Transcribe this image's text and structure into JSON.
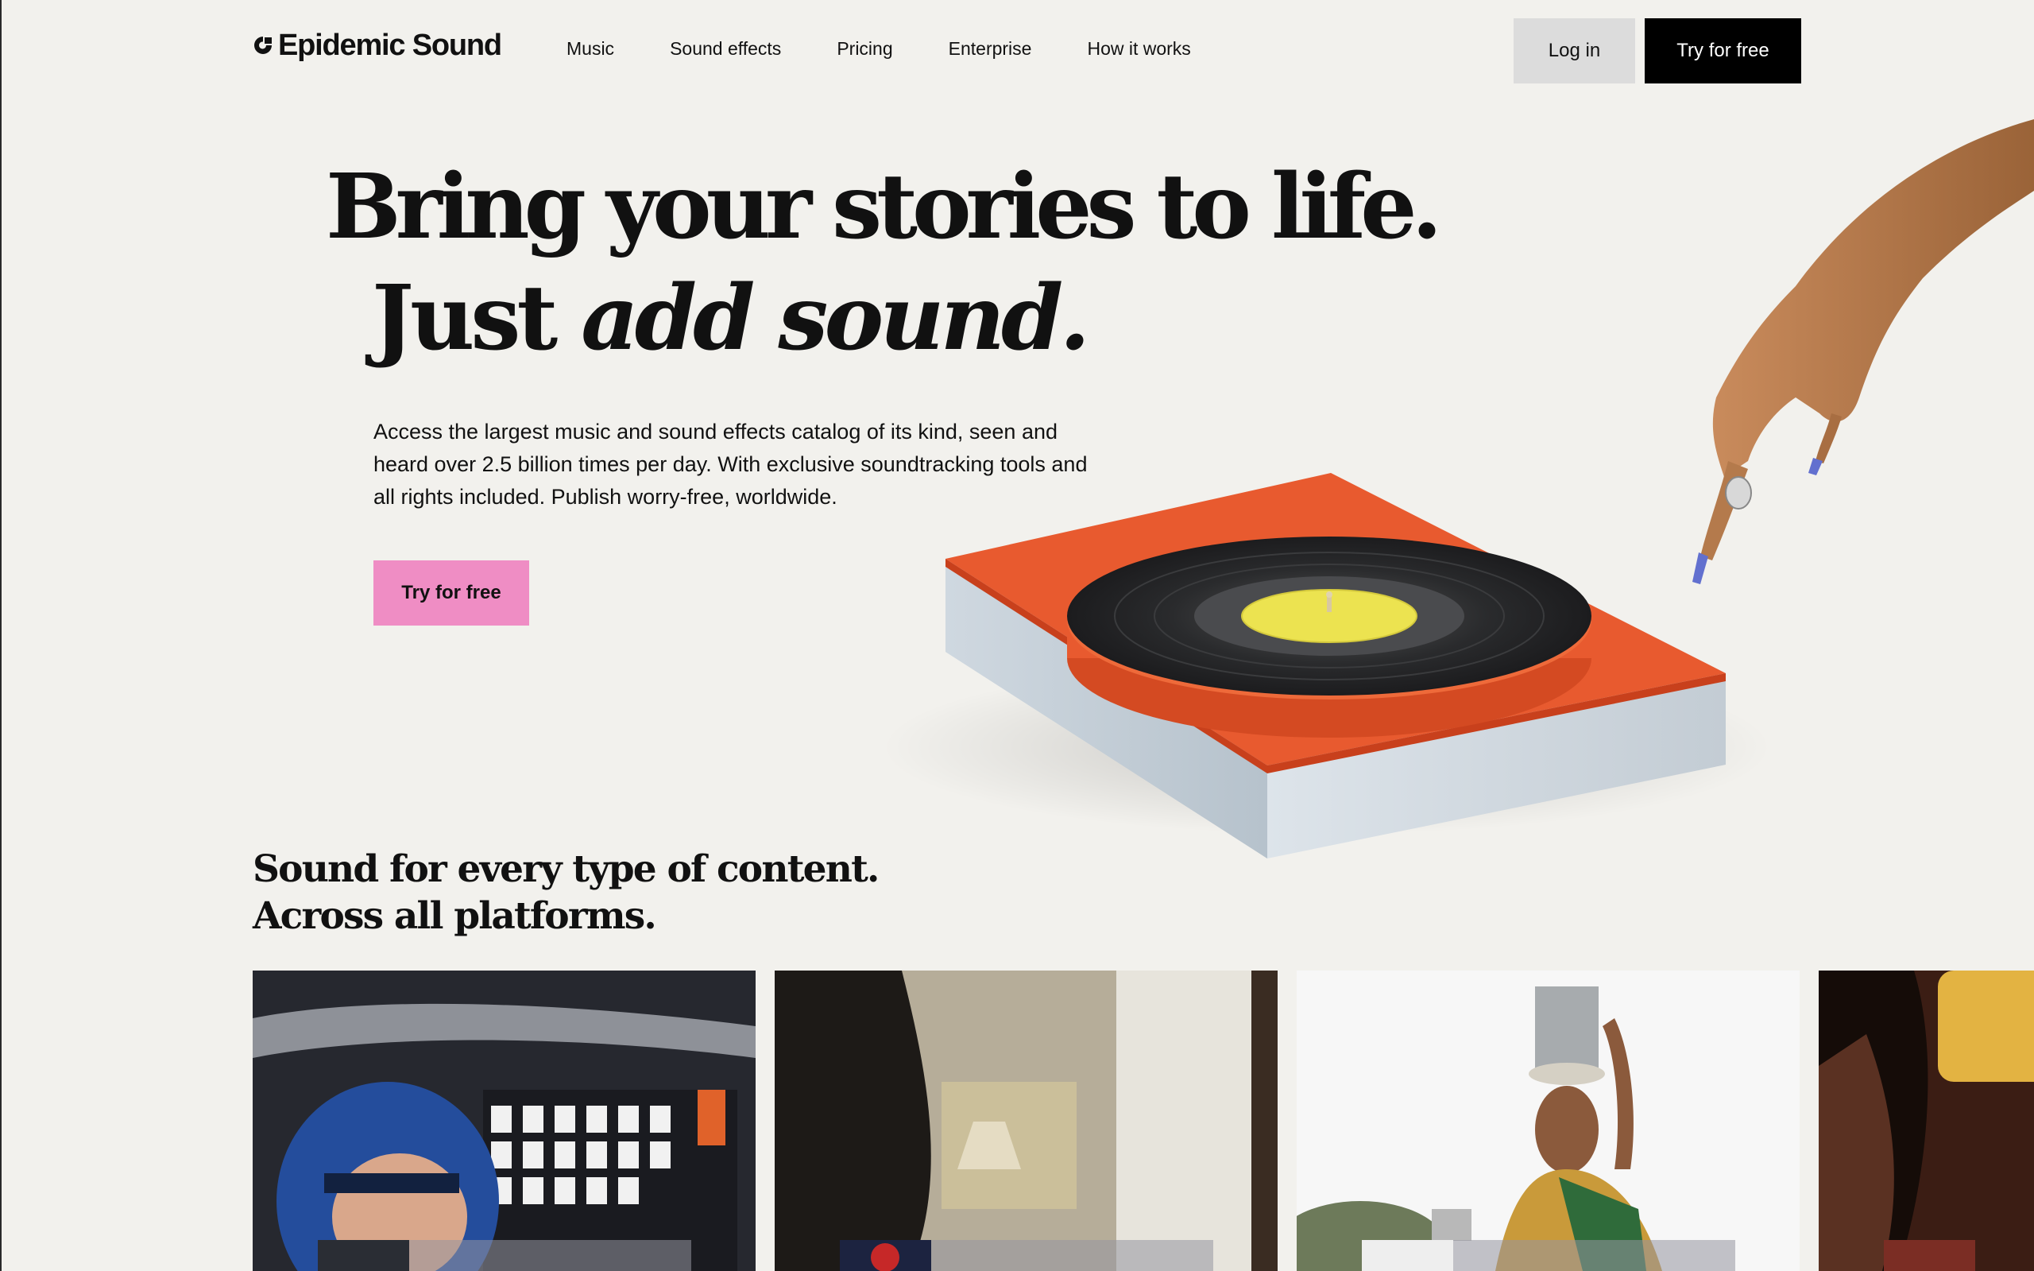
{
  "brand": {
    "name": "Epidemic Sound"
  },
  "nav": {
    "links": [
      "Music",
      "Sound effects",
      "Pricing",
      "Enterprise",
      "How it works"
    ],
    "login_label": "Log in",
    "try_label": "Try for free"
  },
  "hero": {
    "line1": "Bring your stories to life.",
    "line2_plain": "Just ",
    "line2_italic": "add sound.",
    "description": "Access the largest music and sound effects catalog of its kind, seen and heard over 2.5 billion times per day. With exclusive soundtracking tools and all rights included. Publish worry-free, worldwide.",
    "cta_label": "Try for free"
  },
  "section": {
    "title_line1": "Sound for every type of content.",
    "title_line2": "Across all platforms."
  },
  "colors": {
    "accent_pink": "#ef8dc4",
    "nav_cta": "#000000",
    "background": "#f2f1ed",
    "turntable_base": "#e85a2f"
  }
}
